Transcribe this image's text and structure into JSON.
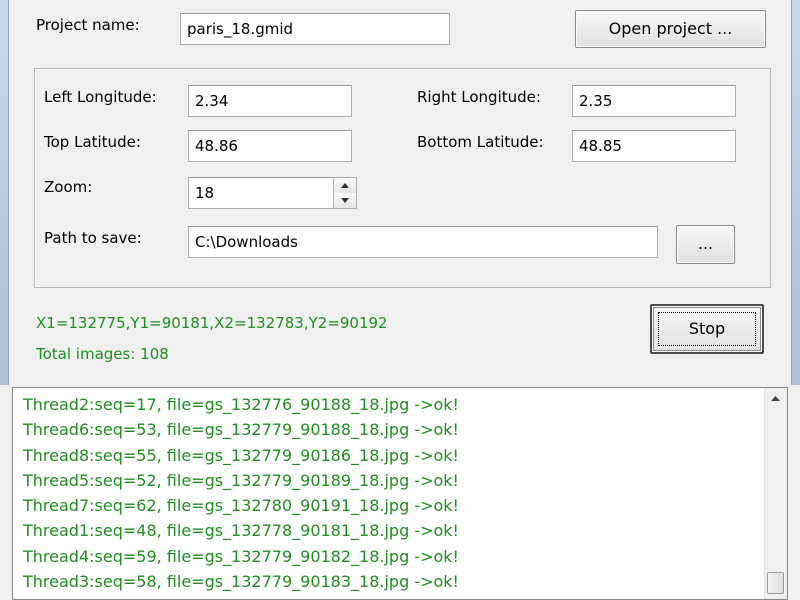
{
  "project": {
    "name_label": "Project name:",
    "name_value": "paris_18.gmid",
    "open_button_label": "Open project ..."
  },
  "coords": {
    "left_longitude_label": "Left Longitude:",
    "left_longitude_value": "2.34",
    "right_longitude_label": "Right Longitude:",
    "right_longitude_value": "2.35",
    "top_latitude_label": "Top Latitude:",
    "top_latitude_value": "48.86",
    "bottom_latitude_label": "Bottom Latitude:",
    "bottom_latitude_value": "48.85",
    "zoom_label": "Zoom:",
    "zoom_value": "18",
    "path_label": "Path to save:",
    "path_value": "C:\\Downloads",
    "browse_button_label": "..."
  },
  "status": {
    "tile_range": "X1=132775,Y1=90181,X2=132783,Y2=90192",
    "total_images": "Total images: 108",
    "stop_button_label": "Stop",
    "status_color": "#1e8f1e"
  },
  "log": {
    "lines": [
      "Thread2:seq=17, file=gs_132776_90188_18.jpg ->ok!",
      "Thread6:seq=53, file=gs_132779_90188_18.jpg ->ok!",
      "Thread8:seq=55, file=gs_132779_90186_18.jpg ->ok!",
      "Thread5:seq=52, file=gs_132779_90189_18.jpg ->ok!",
      "Thread7:seq=62, file=gs_132780_90191_18.jpg ->ok!",
      "Thread1:seq=48, file=gs_132778_90181_18.jpg ->ok!",
      "Thread4:seq=59, file=gs_132779_90182_18.jpg ->ok!",
      "Thread3:seq=58, file=gs_132779_90183_18.jpg ->ok!"
    ],
    "scroll_position": 1.0
  }
}
